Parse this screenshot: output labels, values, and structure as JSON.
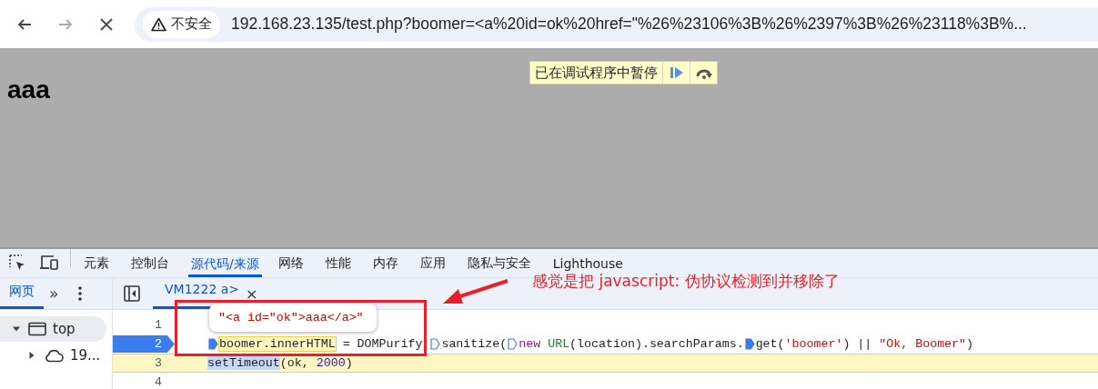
{
  "browser": {
    "nav_buttons": [
      {
        "kind": "back",
        "disabled": false
      },
      {
        "kind": "forward",
        "disabled": true
      },
      {
        "kind": "stop",
        "disabled": false
      }
    ],
    "security_label": "不安全",
    "url": "192.168.23.135/test.php?boomer=<a%20id=ok%20href=\"%26%23106%3B%26%2397%3B%26%23118%3B%..."
  },
  "page": {
    "heading": "aaa",
    "paused_banner": {
      "label": "已在调试程序中暂停"
    }
  },
  "devtools": {
    "tabs": [
      {
        "label": "元素",
        "selected": false
      },
      {
        "label": "控制台",
        "selected": false
      },
      {
        "label": "源代码/来源",
        "selected": true
      },
      {
        "label": "网络",
        "selected": false
      },
      {
        "label": "性能",
        "selected": false
      },
      {
        "label": "内存",
        "selected": false
      },
      {
        "label": "应用",
        "selected": false
      },
      {
        "label": "隐私与安全",
        "selected": false
      },
      {
        "label": "Lighthouse",
        "selected": false
      }
    ],
    "navigator": {
      "tabs": [
        {
          "label": "网页",
          "selected": true
        }
      ],
      "more_tabs": "»",
      "tree": [
        {
          "label": "top",
          "selected": true,
          "expanded": true,
          "children": [
            {
              "label": "19...",
              "selected": false,
              "expanded": false
            }
          ]
        }
      ]
    },
    "editor": {
      "file_tabs": [
        {
          "label": "VM1222 a>",
          "selected": true,
          "close": "×"
        }
      ],
      "tooltip": "\"<a id=\"ok\">aaa</a>\"",
      "lines": [
        {
          "number": "1",
          "breakpoint": false,
          "current": false
        },
        {
          "number": "2",
          "breakpoint": true,
          "current": false,
          "tokens": [
            {
              "kind": "marker",
              "active": true
            },
            {
              "kind": "highlight",
              "text": "boomer.innerHTML"
            },
            {
              "kind": "plain",
              "text": " = DOMPurify "
            },
            {
              "kind": "marker",
              "active": false
            },
            {
              "kind": "plain",
              "text": "sanitize("
            },
            {
              "kind": "marker",
              "active": false
            },
            {
              "kind": "keyword",
              "text": "new"
            },
            {
              "kind": "type",
              "text": " URL"
            },
            {
              "kind": "plain",
              "text": "(location).searchParams."
            },
            {
              "kind": "marker",
              "active": true
            },
            {
              "kind": "plain",
              "text": "get("
            },
            {
              "kind": "string",
              "text": "'boomer'"
            },
            {
              "kind": "plain",
              "text": ") || "
            },
            {
              "kind": "string",
              "text": "\"Ok, Boomer\""
            },
            {
              "kind": "plain",
              "text": ")"
            }
          ]
        },
        {
          "number": "3",
          "breakpoint": false,
          "current": true,
          "tokens": [
            {
              "kind": "selection",
              "text": "setTimeout"
            },
            {
              "kind": "plain",
              "text": "(ok, "
            },
            {
              "kind": "number",
              "text": "2000"
            },
            {
              "kind": "plain",
              "text": ")"
            }
          ]
        },
        {
          "number": "4",
          "breakpoint": false,
          "current": false
        }
      ]
    }
  },
  "annotation": {
    "text": "感觉是把 javascript: 伪协议检测到并移除了"
  }
}
